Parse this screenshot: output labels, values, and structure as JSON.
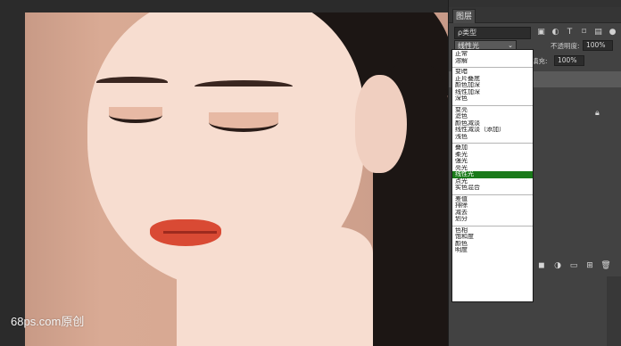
{
  "watermark": "68ps.com原创",
  "panel": {
    "tab_label": "图层",
    "filter": {
      "value": "ρ类型",
      "icons": [
        "image-filter-icon",
        "adjustment-filter-icon",
        "text-filter-icon",
        "shape-filter-icon",
        "smart-object-filter-icon"
      ]
    },
    "blend_mode": "线性光",
    "opacity_label": "不透明度:",
    "opacity_value": "100%",
    "fill_label": "填充:",
    "fill_value": "100%"
  },
  "blend_menu": {
    "groups": [
      [
        "正常",
        "溶解"
      ],
      [
        "变暗",
        "正片叠底",
        "颜色加深",
        "线性加深",
        "深色"
      ],
      [
        "变亮",
        "滤色",
        "颜色减淡",
        "线性减淡（添加）",
        "浅色"
      ],
      [
        "叠加",
        "柔光",
        "强光",
        "亮光",
        "线性光",
        "点光",
        "实色混合"
      ],
      [
        "差值",
        "排除",
        "减去",
        "划分"
      ],
      [
        "色相",
        "饱和度",
        "颜色",
        "明度"
      ]
    ],
    "selected": "线性光"
  },
  "colors": {
    "panel_bg": "#424242",
    "menu_highlight": "#1a7a1a",
    "photo_bg": "#d7a892"
  }
}
